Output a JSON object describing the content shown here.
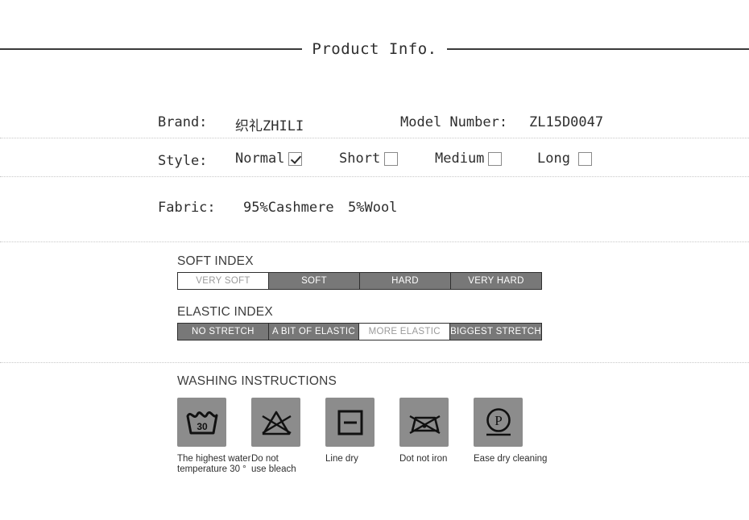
{
  "header": {
    "title": "Product Info."
  },
  "info": {
    "brand_label": "Brand:",
    "brand_value": "织礼ZHILI",
    "model_label": "Model Number:",
    "model_value": "ZL15D0047",
    "style_label": "Style:",
    "style_options": [
      {
        "label": "Normal",
        "checked": true
      },
      {
        "label": "Short",
        "checked": false
      },
      {
        "label": "Medium",
        "checked": false
      },
      {
        "label": "Long",
        "checked": false
      }
    ],
    "fabric_label": "Fabric:",
    "fabric_value_1": "95%Cashmere",
    "fabric_value_2": "5%Wool"
  },
  "soft_index": {
    "title": "SOFT INDEX",
    "cells": [
      {
        "label": "VERY SOFT",
        "active": true
      },
      {
        "label": "SOFT",
        "active": false
      },
      {
        "label": "HARD",
        "active": false
      },
      {
        "label": "VERY HARD",
        "active": false
      }
    ]
  },
  "elastic_index": {
    "title": "ELASTIC INDEX",
    "cells": [
      {
        "label": "NO STRETCH",
        "active": false
      },
      {
        "label": "A BIT OF ELASTIC",
        "active": false
      },
      {
        "label": "MORE ELASTIC",
        "active": true
      },
      {
        "label": "BIGGEST STRETCH",
        "active": false
      }
    ]
  },
  "washing": {
    "title": "WASHING INSTRUCTIONS",
    "items": [
      {
        "icon": "wash-tub-30-icon",
        "caption": "The highest water\ntemperature 30 °",
        "temperature": "30"
      },
      {
        "icon": "do-not-bleach-icon",
        "caption": "Do not\nuse bleach"
      },
      {
        "icon": "line-dry-icon",
        "caption": "Line dry"
      },
      {
        "icon": "do-not-iron-icon",
        "caption": "Dot not iron"
      },
      {
        "icon": "gentle-dry-clean-p-icon",
        "caption": "Ease dry cleaning",
        "symbol": "P"
      }
    ]
  },
  "colors": {
    "bar_inactive_bg": "#787878",
    "bar_active_bg": "#ffffff",
    "bar_border": "#2f2f2f",
    "icon_bg": "#8c8c8c",
    "text": "#2e2e2e",
    "separator": "#c8c8c8"
  }
}
